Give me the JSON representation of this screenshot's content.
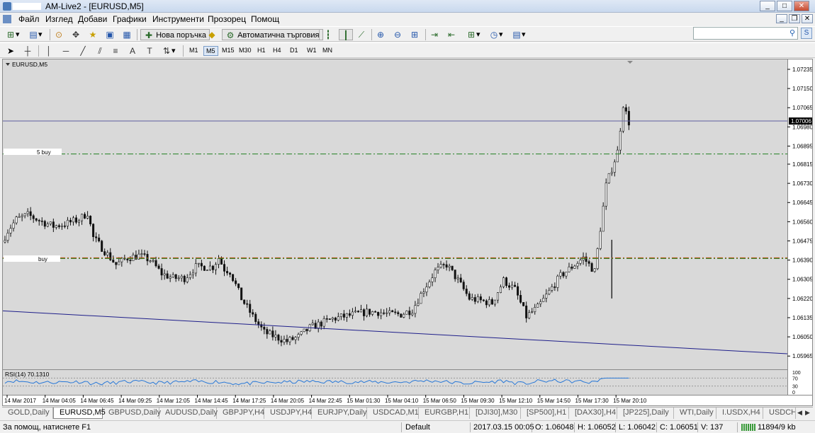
{
  "window": {
    "title": "AM-Live2 - [EURUSD,M5]",
    "min": "_",
    "max": "□",
    "close": "✕",
    "inner_min": "_",
    "inner_max": "❐",
    "inner_close": "✕"
  },
  "menu": [
    "Файл",
    "Изглед",
    "Добави",
    "Графики",
    "Инструменти",
    "Прозорец",
    "Помощ"
  ],
  "toolbar": {
    "new_order": "Нова поръчка",
    "auto_trading": "Автоматична търговия",
    "search_placeholder": ""
  },
  "timeframes": [
    "M1",
    "M5",
    "M15",
    "M30",
    "H1",
    "H4",
    "D1",
    "W1",
    "MN"
  ],
  "active_timeframe": "M5",
  "chart": {
    "symbol_label": "EURUSD,M5",
    "y_ticks": [
      "1.07235",
      "1.07150",
      "1.07065",
      "1.06980",
      "1.06895",
      "1.06815",
      "1.06730",
      "1.06645",
      "1.06560",
      "1.06475",
      "1.06390",
      "1.06305",
      "1.06220",
      "1.06135",
      "1.06050",
      "1.05965"
    ],
    "current_price": "1.07006",
    "x_labels": [
      "14 Mar 2017",
      "14 Mar 04:05",
      "14 Mar 06:45",
      "14 Mar 09:25",
      "14 Mar 12:05",
      "14 Mar 14:45",
      "14 Mar 17:25",
      "14 Mar 20:05",
      "14 Mar 22:45",
      "15 Mar 01:30",
      "15 Mar 04:10",
      "15 Mar 06:50",
      "15 Mar 09:30",
      "15 Mar 12:10",
      "15 Mar 14:50",
      "15 Mar 17:30",
      "15 Mar 20:10"
    ],
    "line_label_1": "5 buy",
    "line_label_2": "buy",
    "rsi_label": "RSI(14) 70.1310",
    "rsi_ticks": [
      "100",
      "70",
      "30",
      "0"
    ]
  },
  "chart_data": {
    "type": "candlestick",
    "symbol": "EURUSD",
    "timeframe": "M5",
    "ylim": [
      1.05925,
      1.0726
    ],
    "price_path": [
      [
        0,
        1.0647
      ],
      [
        2,
        1.0652
      ],
      [
        5,
        1.0657
      ],
      [
        9,
        1.0659
      ],
      [
        14,
        1.0656
      ],
      [
        18,
        1.0654
      ],
      [
        22,
        1.0655
      ],
      [
        27,
        1.0657
      ],
      [
        30,
        1.066
      ],
      [
        32,
        1.0649
      ],
      [
        36,
        1.0643
      ],
      [
        40,
        1.0637
      ],
      [
        44,
        1.064
      ],
      [
        48,
        1.0641
      ],
      [
        52,
        1.0639
      ],
      [
        56,
        1.0633
      ],
      [
        60,
        1.0631
      ],
      [
        64,
        1.0631
      ],
      [
        68,
        1.0636
      ],
      [
        71,
        1.0636
      ],
      [
        74,
        1.0636
      ],
      [
        76,
        1.064
      ],
      [
        78,
        1.0635
      ],
      [
        80,
        1.0634
      ],
      [
        84,
        1.0622
      ],
      [
        88,
        1.0614
      ],
      [
        92,
        1.0607
      ],
      [
        96,
        1.0605
      ],
      [
        100,
        1.0603
      ],
      [
        104,
        1.0605
      ],
      [
        108,
        1.0609
      ],
      [
        112,
        1.0611
      ],
      [
        116,
        1.0613
      ],
      [
        120,
        1.0614
      ],
      [
        124,
        1.0615
      ],
      [
        128,
        1.0616
      ],
      [
        132,
        1.0616
      ],
      [
        136,
        1.0615
      ],
      [
        140,
        1.0615
      ],
      [
        144,
        1.0617
      ],
      [
        148,
        1.0626
      ],
      [
        152,
        1.0634
      ],
      [
        156,
        1.0637
      ],
      [
        160,
        1.063
      ],
      [
        164,
        1.0622
      ],
      [
        168,
        1.0621
      ],
      [
        172,
        1.062
      ],
      [
        176,
        1.063
      ],
      [
        180,
        1.0626
      ],
      [
        184,
        1.0614
      ],
      [
        188,
        1.0618
      ],
      [
        192,
        1.0625
      ],
      [
        196,
        1.0632
      ],
      [
        200,
        1.0636
      ],
      [
        204,
        1.064
      ],
      [
        208,
        1.0634
      ],
      [
        212,
        1.0672
      ],
      [
        216,
        1.0687
      ],
      [
        218,
        1.0708
      ],
      [
        220,
        1.07
      ]
    ],
    "horizontal_lines": [
      {
        "price": 1.07006,
        "color": "#6060a0",
        "style": "solid"
      },
      {
        "price": 1.0686,
        "color": "#208020",
        "style": "dash-dot"
      },
      {
        "price": 1.064,
        "color": "#c04000",
        "style": "dash-dot"
      },
      {
        "price": 1.064,
        "color": "#208020",
        "style": "dash-dot"
      }
    ],
    "trendline": {
      "color": "#1e1e8a"
    },
    "rsi": {
      "period": 14,
      "value": 70.131,
      "levels": [
        70,
        30
      ],
      "ylim": [
        0,
        100
      ],
      "color": "#2878d8"
    },
    "colors": {
      "background": "#d9d9d9",
      "candles": "#111111",
      "grid": "#c8c8c8"
    }
  },
  "tabs": [
    "GOLD,Daily",
    "EURUSD,M5",
    "GBPUSD,Daily",
    "AUDUSD,Daily",
    "GBPJPY,H4",
    "USDJPY,H4",
    "EURJPY,Daily",
    "USDCAD,M1",
    "EURGBP,H1",
    "[DJI30],M30",
    "[SP500],H1",
    "[DAX30],H4",
    "[JP225],Daily",
    "WTI,Daily",
    "I.USDX,H4",
    "USDCHF"
  ],
  "active_tab": "EURUSD,M5",
  "status": {
    "help": "За помощ, натиснете F1",
    "profile": "Default",
    "datetime": "2017.03.15 00:05",
    "open": "O: 1.06048",
    "high": "H: 1.06052",
    "low": "L: 1.06042",
    "close": "C: 1.06051",
    "volume": "V: 137",
    "traffic": "11894/9 kb"
  }
}
